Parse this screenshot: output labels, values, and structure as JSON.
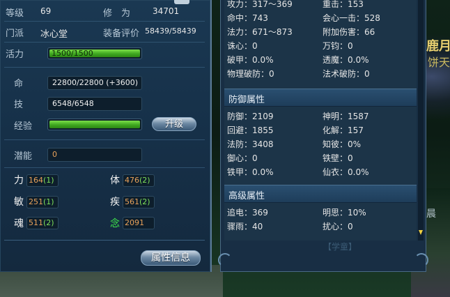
{
  "background": {
    "right_text_1": "鹿月",
    "right_text_2": "饼天",
    "right_text_3": "晨",
    "ghost_label": "【学童】"
  },
  "left": {
    "level": {
      "label": "等级",
      "value": "69"
    },
    "cultivation": {
      "label": "修　为",
      "value": "34701"
    },
    "sect": {
      "label": "门派",
      "value": "冰心堂"
    },
    "equip": {
      "label": "装备评价",
      "value": "58439/58439"
    },
    "vitality": {
      "label": "活力",
      "value": "1500/1500",
      "fill": 1.0
    },
    "hp": {
      "label": "命",
      "value": "22800/22800 (+3600)"
    },
    "skill": {
      "label": "技",
      "value": "6548/6548"
    },
    "exp": {
      "label": "经验",
      "fill": 1.0,
      "button": "升级"
    },
    "potential": {
      "label": "潜能",
      "value": "0"
    },
    "stats": [
      {
        "label": "力",
        "base": "164",
        "bonus": "(1)"
      },
      {
        "label": "体",
        "base": "476",
        "bonus": "(2)"
      },
      {
        "label": "敏",
        "base": "251",
        "bonus": "(1)"
      },
      {
        "label": "疾",
        "base": "561",
        "bonus": "(2)"
      },
      {
        "label": "魂",
        "base": "511",
        "bonus": "(2)"
      },
      {
        "label": "念",
        "base": "2091",
        "bonus": ""
      }
    ],
    "attr_button": "属性信息"
  },
  "right": {
    "attack_rows": [
      {
        "a": "攻力：317～369",
        "b": "重击：153"
      },
      {
        "a": "命中：743",
        "b": "会心一击：528"
      },
      {
        "a": "法力：671～873",
        "b": "附加伤害：66"
      },
      {
        "a": "诛心：0",
        "b": "万钧：0"
      },
      {
        "a": "破甲：0.0%",
        "b": "透魔：0.0%"
      },
      {
        "a": "物理破防：0",
        "b": "法术破防：0"
      }
    ],
    "defense_header": "防御属性",
    "defense_rows": [
      {
        "a": "防御：2109",
        "b": "神明：1587"
      },
      {
        "a": "回避：1855",
        "b": "化解：157"
      },
      {
        "a": "法防：3408",
        "b": "知彼：0%"
      },
      {
        "a": "御心：0",
        "b": "铁壁：0"
      },
      {
        "a": "铁甲：0.0%",
        "b": "仙衣：0.0%"
      }
    ],
    "advanced_header": "高级属性",
    "advanced_rows": [
      {
        "a": "追电：369",
        "b": "明思：10%"
      },
      {
        "a": "骤雨：40",
        "b": "扰心：0"
      }
    ]
  },
  "colors": {
    "bar_green": "#4fc22a",
    "value_orange": "#e9a25a",
    "bonus_green": "#7ee05a",
    "nian_green": "#3fe84a"
  }
}
